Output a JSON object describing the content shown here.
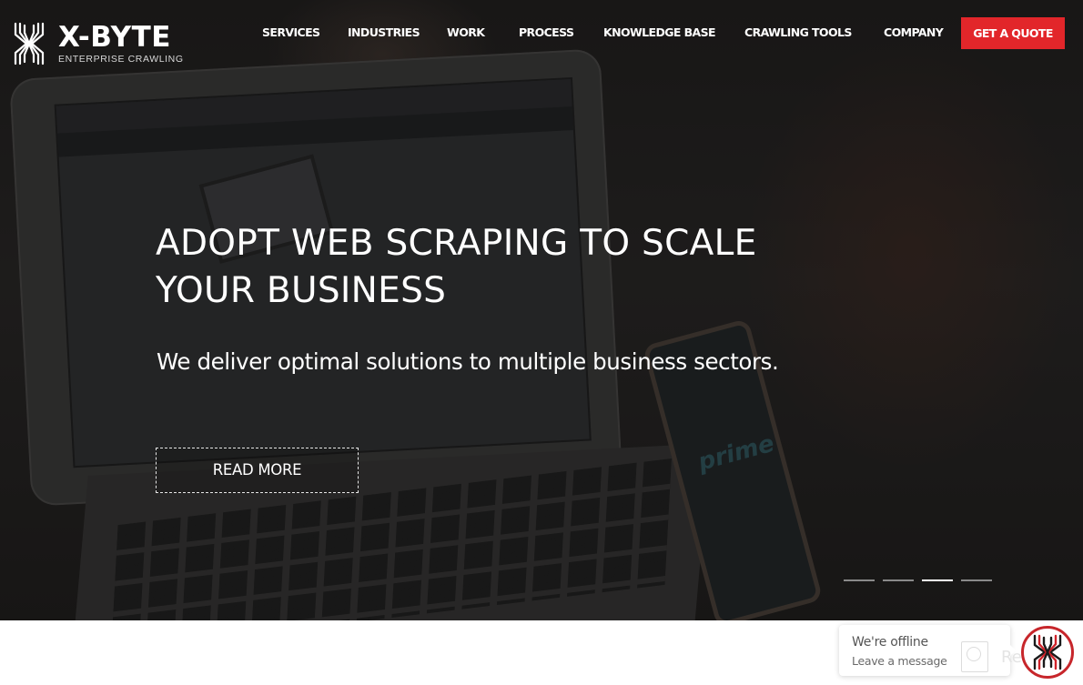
{
  "brand": {
    "name": "X-BYTE",
    "tagline": "ENTERPRISE CRAWLING",
    "logo_icon": "x-byte-logo-icon",
    "accent_color": "#e2262a"
  },
  "nav": {
    "items": [
      {
        "label": "SERVICES"
      },
      {
        "label": "INDUSTRIES"
      },
      {
        "label": "WORK"
      },
      {
        "label": "PROCESS"
      },
      {
        "label": "KNOWLEDGE BASE"
      },
      {
        "label": "CRAWLING TOOLS"
      },
      {
        "label": "COMPANY"
      }
    ],
    "cta_label": "GET A QUOTE"
  },
  "hero": {
    "title_line1": "ADOPT WEB SCRAPING TO SCALE",
    "title_line2": "YOUR BUSINESS",
    "subtitle": "We deliver optimal solutions to multiple business sectors.",
    "button_label": "READ MORE",
    "background_image": "laptop and smartphone showing shopping site",
    "phone_text": "prime",
    "slides": {
      "count": 4,
      "active_index": 2
    }
  },
  "chat": {
    "status": "We're offline",
    "message": "Leave a message",
    "watermark_text": "Revain",
    "avatar_icon": "x-byte-avatar-icon"
  }
}
